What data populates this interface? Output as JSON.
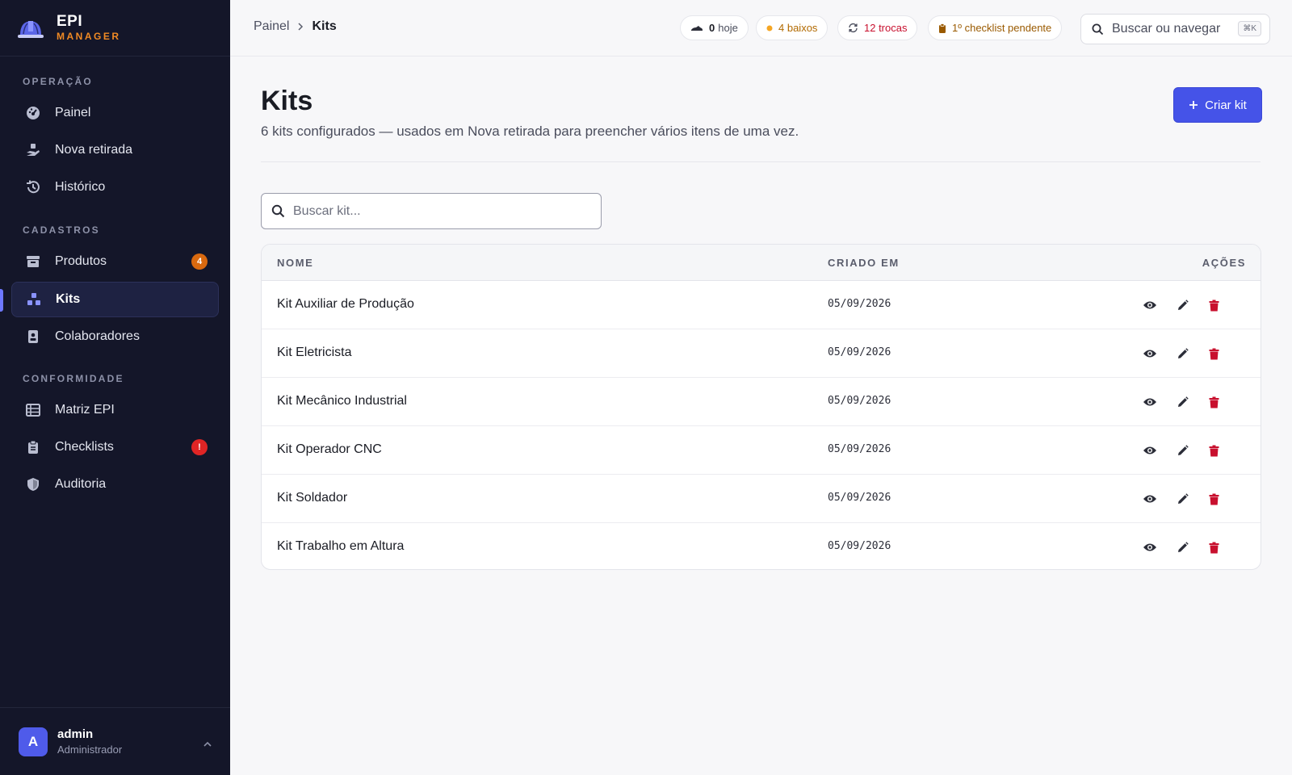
{
  "brand": {
    "name": "EPI",
    "sub": "MANAGER"
  },
  "sidebar": {
    "sections": [
      {
        "label": "OPERAÇÃO"
      },
      {
        "label": "CADASTROS"
      },
      {
        "label": "CONFORMIDADE"
      }
    ],
    "items": [
      {
        "label": "Painel",
        "icon": "dashboard-icon"
      },
      {
        "label": "Nova retirada",
        "icon": "hand-withdraw-icon"
      },
      {
        "label": "Histórico",
        "icon": "history-icon"
      },
      {
        "label": "Produtos",
        "icon": "box-icon",
        "badge": "4"
      },
      {
        "label": "Kits",
        "icon": "kits-icon",
        "active": true
      },
      {
        "label": "Colaboradores",
        "icon": "id-badge-icon"
      },
      {
        "label": "Matriz EPI",
        "icon": "table-icon"
      },
      {
        "label": "Checklists",
        "icon": "clipboard-icon",
        "badge": "!"
      },
      {
        "label": "Auditoria",
        "icon": "shield-icon"
      }
    ]
  },
  "user": {
    "initial": "A",
    "name": "admin",
    "role": "Administrador"
  },
  "breadcrumb": {
    "home": "Painel",
    "current": "Kits"
  },
  "status_chips": {
    "today": {
      "count": "0",
      "label": "hoje"
    },
    "low": "4 baixos",
    "exchanges": "12 trocas",
    "checklist": "1º checklist pendente"
  },
  "global_search": {
    "placeholder": "Buscar ou navegar",
    "shortcut": "⌘K"
  },
  "page": {
    "title": "Kits",
    "subtitle": "6 kits configurados — usados em Nova retirada para preencher vários itens de uma vez.",
    "create_button": "Criar kit"
  },
  "kit_search": {
    "placeholder": "Buscar kit..."
  },
  "table": {
    "columns": {
      "name": "NOME",
      "created": "CRIADO EM",
      "actions": "AÇÕES"
    },
    "rows": [
      {
        "name": "Kit Auxiliar de Produção",
        "created": "05/09/2026"
      },
      {
        "name": "Kit Eletricista",
        "created": "05/09/2026"
      },
      {
        "name": "Kit Mecânico Industrial",
        "created": "05/09/2026"
      },
      {
        "name": "Kit Operador CNC",
        "created": "05/09/2026"
      },
      {
        "name": "Kit Soldador",
        "created": "05/09/2026"
      },
      {
        "name": "Kit Trabalho em Altura",
        "created": "05/09/2026"
      }
    ]
  },
  "colors": {
    "sidebar_bg": "#141629",
    "accent": "#4553e8",
    "brand_orange": "#f08a24",
    "danger": "#c8102e",
    "warning_dot": "#f5a623"
  }
}
